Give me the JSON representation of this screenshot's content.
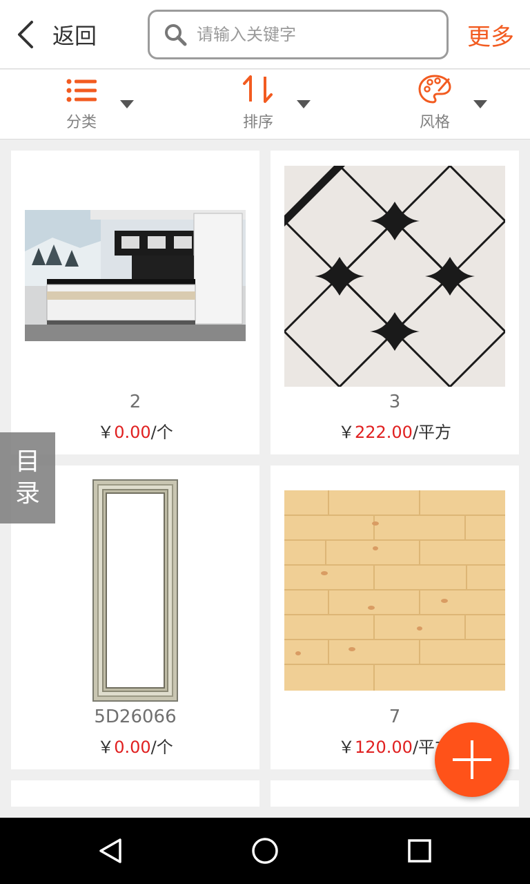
{
  "header": {
    "back_label": "返回",
    "search_placeholder": "请输入关键字",
    "more_label": "更多",
    "accent_color": "#f25b20"
  },
  "filters": [
    {
      "label": "分类",
      "icon": "list-icon"
    },
    {
      "label": "排序",
      "icon": "sort-icon"
    },
    {
      "label": "风格",
      "icon": "palette-icon"
    }
  ],
  "products": [
    {
      "name": "2",
      "currency": "￥",
      "price": "0.00",
      "unit": "/个",
      "image": "kitchen-cabinet-image"
    },
    {
      "name": "3",
      "currency": "￥",
      "price": "222.00",
      "unit": "/平方",
      "image": "diamond-tile-image"
    },
    {
      "name": "5D26066",
      "currency": "￥",
      "price": "0.00",
      "unit": "/个",
      "image": "door-frame-image"
    },
    {
      "name": "7",
      "currency": "￥",
      "price": "120.00",
      "unit": "/平方",
      "image": "wood-floor-image"
    }
  ],
  "side_tab": {
    "label_1": "目",
    "label_2": "录"
  },
  "fab": {
    "icon": "plus-icon",
    "color": "#ff5219"
  },
  "navbar": {
    "icons": [
      "back-triangle-icon",
      "home-circle-icon",
      "recents-square-icon"
    ]
  }
}
